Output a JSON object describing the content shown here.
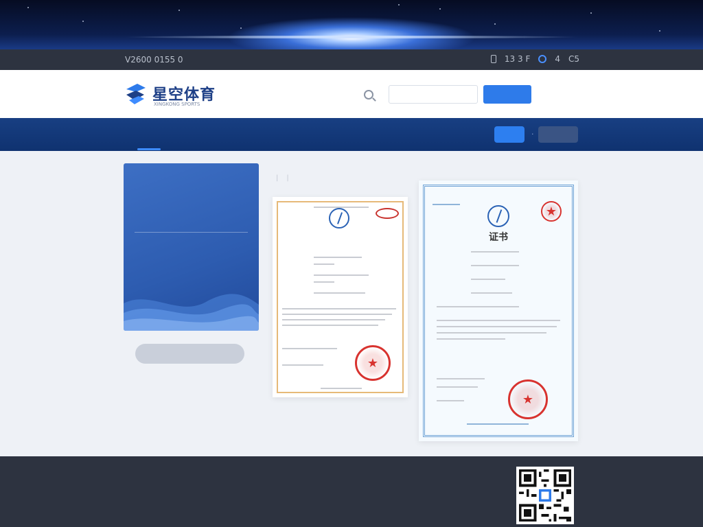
{
  "topbar": {
    "left_text": "V2600 0155 0",
    "phone_text": "13 3 F",
    "mail_text": "4",
    "right_text": "C5"
  },
  "header": {
    "brand": "星空体育",
    "brand_sub": "XINGKONG SPORTS",
    "search_label": "",
    "search_placeholder": "",
    "search_button": ""
  },
  "nav": {
    "items": [
      "",
      "",
      "",
      "",
      ""
    ],
    "login": "",
    "register": ""
  },
  "sidebar": {
    "line1": "",
    "line2": "",
    "heading": "",
    "item1": "",
    "item2": "",
    "button": ""
  },
  "breadcrumb": {
    "first": "",
    "second": "",
    "current": ""
  },
  "cert_left": {
    "title": "",
    "fields": [
      "",
      "",
      ""
    ]
  },
  "cert_right": {
    "title": "证书",
    "fields": [
      "",
      "",
      "",
      ""
    ]
  },
  "footer": {
    "col1_title": "",
    "col1_sub": "",
    "col2_title": "",
    "copyright": "",
    "icp": ""
  },
  "colors": {
    "accent": "#2e7bea",
    "nav_bg": "#183f82",
    "footer_bg": "#2d3340",
    "seal_red": "#d8332f"
  }
}
